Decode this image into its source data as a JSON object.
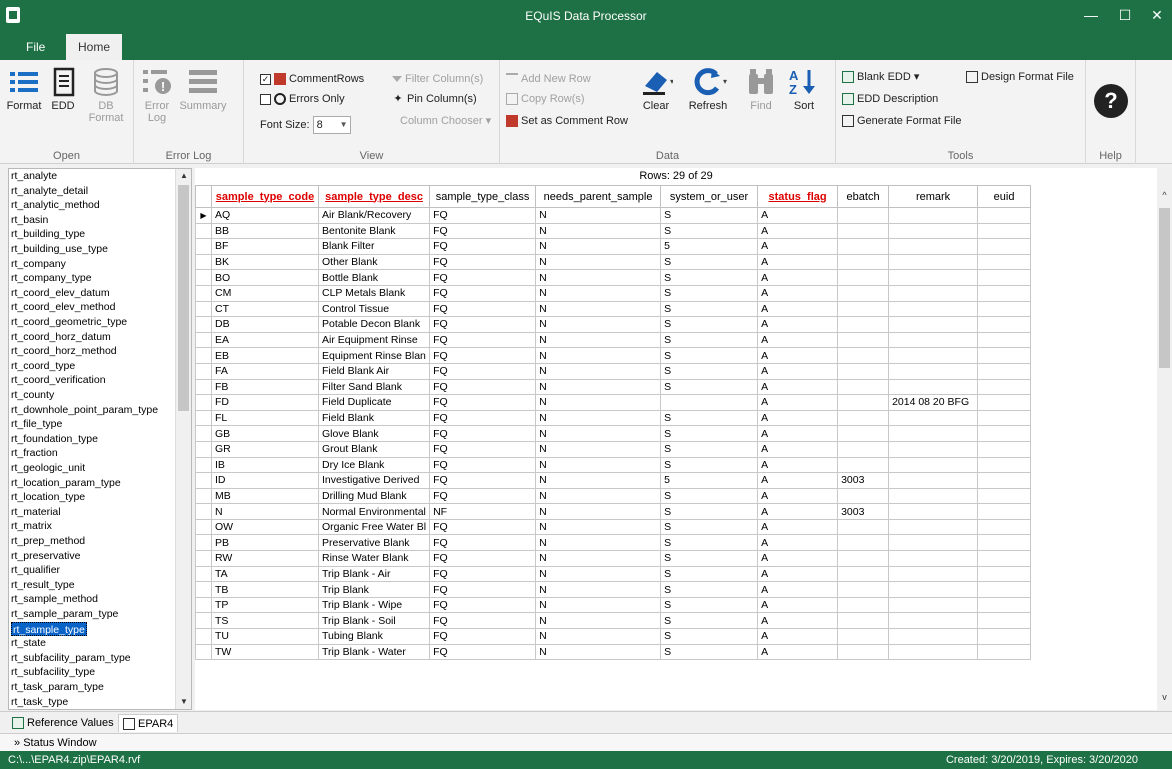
{
  "window": {
    "title": "EQuIS Data Processor",
    "min": "—",
    "max": "☐",
    "close": "✕"
  },
  "tabs": [
    {
      "label": "File"
    },
    {
      "label": "Home"
    }
  ],
  "ribbon": {
    "open": {
      "label": "Open",
      "format": "Format",
      "edd": "EDD",
      "db_format_1": "DB",
      "db_format_2": "Format"
    },
    "error_log": {
      "label": "Error Log",
      "error_log_1": "Error",
      "error_log_2": "Log",
      "summary": "Summary"
    },
    "view": {
      "label": "View",
      "comment_rows": "CommentRows",
      "errors_only": "Errors Only",
      "font_size_label": "Font Size:",
      "font_size": "8",
      "filter_columns": "Filter Column(s)",
      "pin_columns": "Pin Column(s)",
      "column_chooser": "Column Chooser"
    },
    "data": {
      "label": "Data",
      "add_new_row": "Add New Row",
      "copy_rows": "Copy Row(s)",
      "set_comment_row": "Set as Comment Row",
      "clear": "Clear",
      "refresh": "Refresh",
      "find": "Find",
      "sort": "Sort"
    },
    "tools": {
      "label": "Tools",
      "blank_edd": "Blank EDD",
      "edd_description": "EDD Description",
      "generate_format_file": "Generate Format File",
      "design_format_file": "Design Format File"
    },
    "help": {
      "label": "Help"
    }
  },
  "left_list": {
    "items": [
      "rt_analyte",
      "rt_analyte_detail",
      "rt_analytic_method",
      "rt_basin",
      "rt_building_type",
      "rt_building_use_type",
      "rt_company",
      "rt_company_type",
      "rt_coord_elev_datum",
      "rt_coord_elev_method",
      "rt_coord_geometric_type",
      "rt_coord_horz_datum",
      "rt_coord_horz_method",
      "rt_coord_type",
      "rt_coord_verification",
      "rt_county",
      "rt_downhole_point_param_type",
      "rt_file_type",
      "rt_foundation_type",
      "rt_fraction",
      "rt_geologic_unit",
      "rt_location_param_type",
      "rt_location_type",
      "rt_material",
      "rt_matrix",
      "rt_prep_method",
      "rt_preservative",
      "rt_qualifier",
      "rt_result_type",
      "rt_sample_method",
      "rt_sample_param_type",
      "rt_sample_type",
      "rt_state",
      "rt_subfacility_param_type",
      "rt_subfacility_type",
      "rt_task_param_type",
      "rt_task_type"
    ],
    "selected": "rt_sample_type"
  },
  "grid": {
    "rows_info": "Rows: 29 of 29",
    "columns": [
      {
        "label": "sample_type_code",
        "required": true
      },
      {
        "label": "sample_type_desc",
        "required": true
      },
      {
        "label": "sample_type_class",
        "required": false
      },
      {
        "label": "needs_parent_sample",
        "required": false
      },
      {
        "label": "system_or_user",
        "required": false
      },
      {
        "label": "status_flag",
        "required": true
      },
      {
        "label": "ebatch",
        "required": false
      },
      {
        "label": "remark",
        "required": false
      },
      {
        "label": "euid",
        "required": false
      }
    ],
    "rows": [
      [
        "AQ",
        "Air Blank/Recovery",
        "FQ",
        "N",
        "S",
        "A",
        "",
        "",
        ""
      ],
      [
        "BB",
        "Bentonite Blank",
        "FQ",
        "N",
        "S",
        "A",
        "",
        "",
        ""
      ],
      [
        "BF",
        "Blank Filter",
        "FQ",
        "N",
        "5",
        "A",
        "",
        "",
        ""
      ],
      [
        "BK",
        "Other Blank",
        "FQ",
        "N",
        "S",
        "A",
        "",
        "",
        ""
      ],
      [
        "BO",
        "Bottle Blank",
        "FQ",
        "N",
        "S",
        "A",
        "",
        "",
        ""
      ],
      [
        "CM",
        "CLP Metals Blank",
        "FQ",
        "N",
        "S",
        "A",
        "",
        "",
        ""
      ],
      [
        "CT",
        "Control Tissue",
        "FQ",
        "N",
        "S",
        "A",
        "",
        "",
        ""
      ],
      [
        "DB",
        "Potable Decon Blank",
        "FQ",
        "N",
        "S",
        "A",
        "",
        "",
        ""
      ],
      [
        "EA",
        "Air Equipment Rinse",
        "FQ",
        "N",
        "S",
        "A",
        "",
        "",
        ""
      ],
      [
        "EB",
        "Equipment Rinse Blan",
        "FQ",
        "N",
        "S",
        "A",
        "",
        "",
        ""
      ],
      [
        "FA",
        "Field Blank Air",
        "FQ",
        "N",
        "S",
        "A",
        "",
        "",
        ""
      ],
      [
        "FB",
        "Filter Sand Blank",
        "FQ",
        "N",
        "S",
        "A",
        "",
        "",
        ""
      ],
      [
        "FD",
        "Field Duplicate",
        "FQ",
        "N",
        "",
        "A",
        "",
        "2014 08 20 BFG",
        ""
      ],
      [
        "FL",
        "Field Blank",
        "FQ",
        "N",
        "S",
        "A",
        "",
        "",
        ""
      ],
      [
        "GB",
        "Glove Blank",
        "FQ",
        "N",
        "S",
        "A",
        "",
        "",
        ""
      ],
      [
        "GR",
        "Grout Blank",
        "FQ",
        "N",
        "S",
        "A",
        "",
        "",
        ""
      ],
      [
        "IB",
        "Dry Ice Blank",
        "FQ",
        "N",
        "S",
        "A",
        "",
        "",
        ""
      ],
      [
        "ID",
        "Investigative Derived",
        "FQ",
        "N",
        "5",
        "A",
        "3003",
        "",
        ""
      ],
      [
        "MB",
        "Drilling Mud Blank",
        "FQ",
        "N",
        "S",
        "A",
        "",
        "",
        ""
      ],
      [
        "N",
        "Normal Environmental",
        "NF",
        "N",
        "S",
        "A",
        "3003",
        "",
        ""
      ],
      [
        "OW",
        "Organic Free Water Bl",
        "FQ",
        "N",
        "S",
        "A",
        "",
        "",
        ""
      ],
      [
        "PB",
        "Preservative Blank",
        "FQ",
        "N",
        "S",
        "A",
        "",
        "",
        ""
      ],
      [
        "RW",
        "Rinse Water Blank",
        "FQ",
        "N",
        "S",
        "A",
        "",
        "",
        ""
      ],
      [
        "TA",
        "Trip Blank - Air",
        "FQ",
        "N",
        "S",
        "A",
        "",
        "",
        ""
      ],
      [
        "TB",
        "Trip Blank",
        "FQ",
        "N",
        "S",
        "A",
        "",
        "",
        ""
      ],
      [
        "TP",
        "Trip Blank - Wipe",
        "FQ",
        "N",
        "S",
        "A",
        "",
        "",
        ""
      ],
      [
        "TS",
        "Trip Blank - Soil",
        "FQ",
        "N",
        "S",
        "A",
        "",
        "",
        ""
      ],
      [
        "TU",
        "Tubing Blank",
        "FQ",
        "N",
        "S",
        "A",
        "",
        "",
        ""
      ],
      [
        "TW",
        "Trip Blank - Water",
        "FQ",
        "N",
        "S",
        "A",
        "",
        "",
        ""
      ]
    ]
  },
  "bottom_tabs": [
    {
      "label": "Reference Values"
    },
    {
      "label": "EPAR4"
    }
  ],
  "status_window": "Status Window",
  "statusbar": {
    "path": "C:\\...\\EPAR4.zip\\EPAR4.rvf",
    "created": "Created: 3/20/2019, Expires: 3/20/2020"
  },
  "colors": {
    "brand": "#1e7145",
    "required_header": "#dd0000",
    "selection": "#0a64c8"
  }
}
